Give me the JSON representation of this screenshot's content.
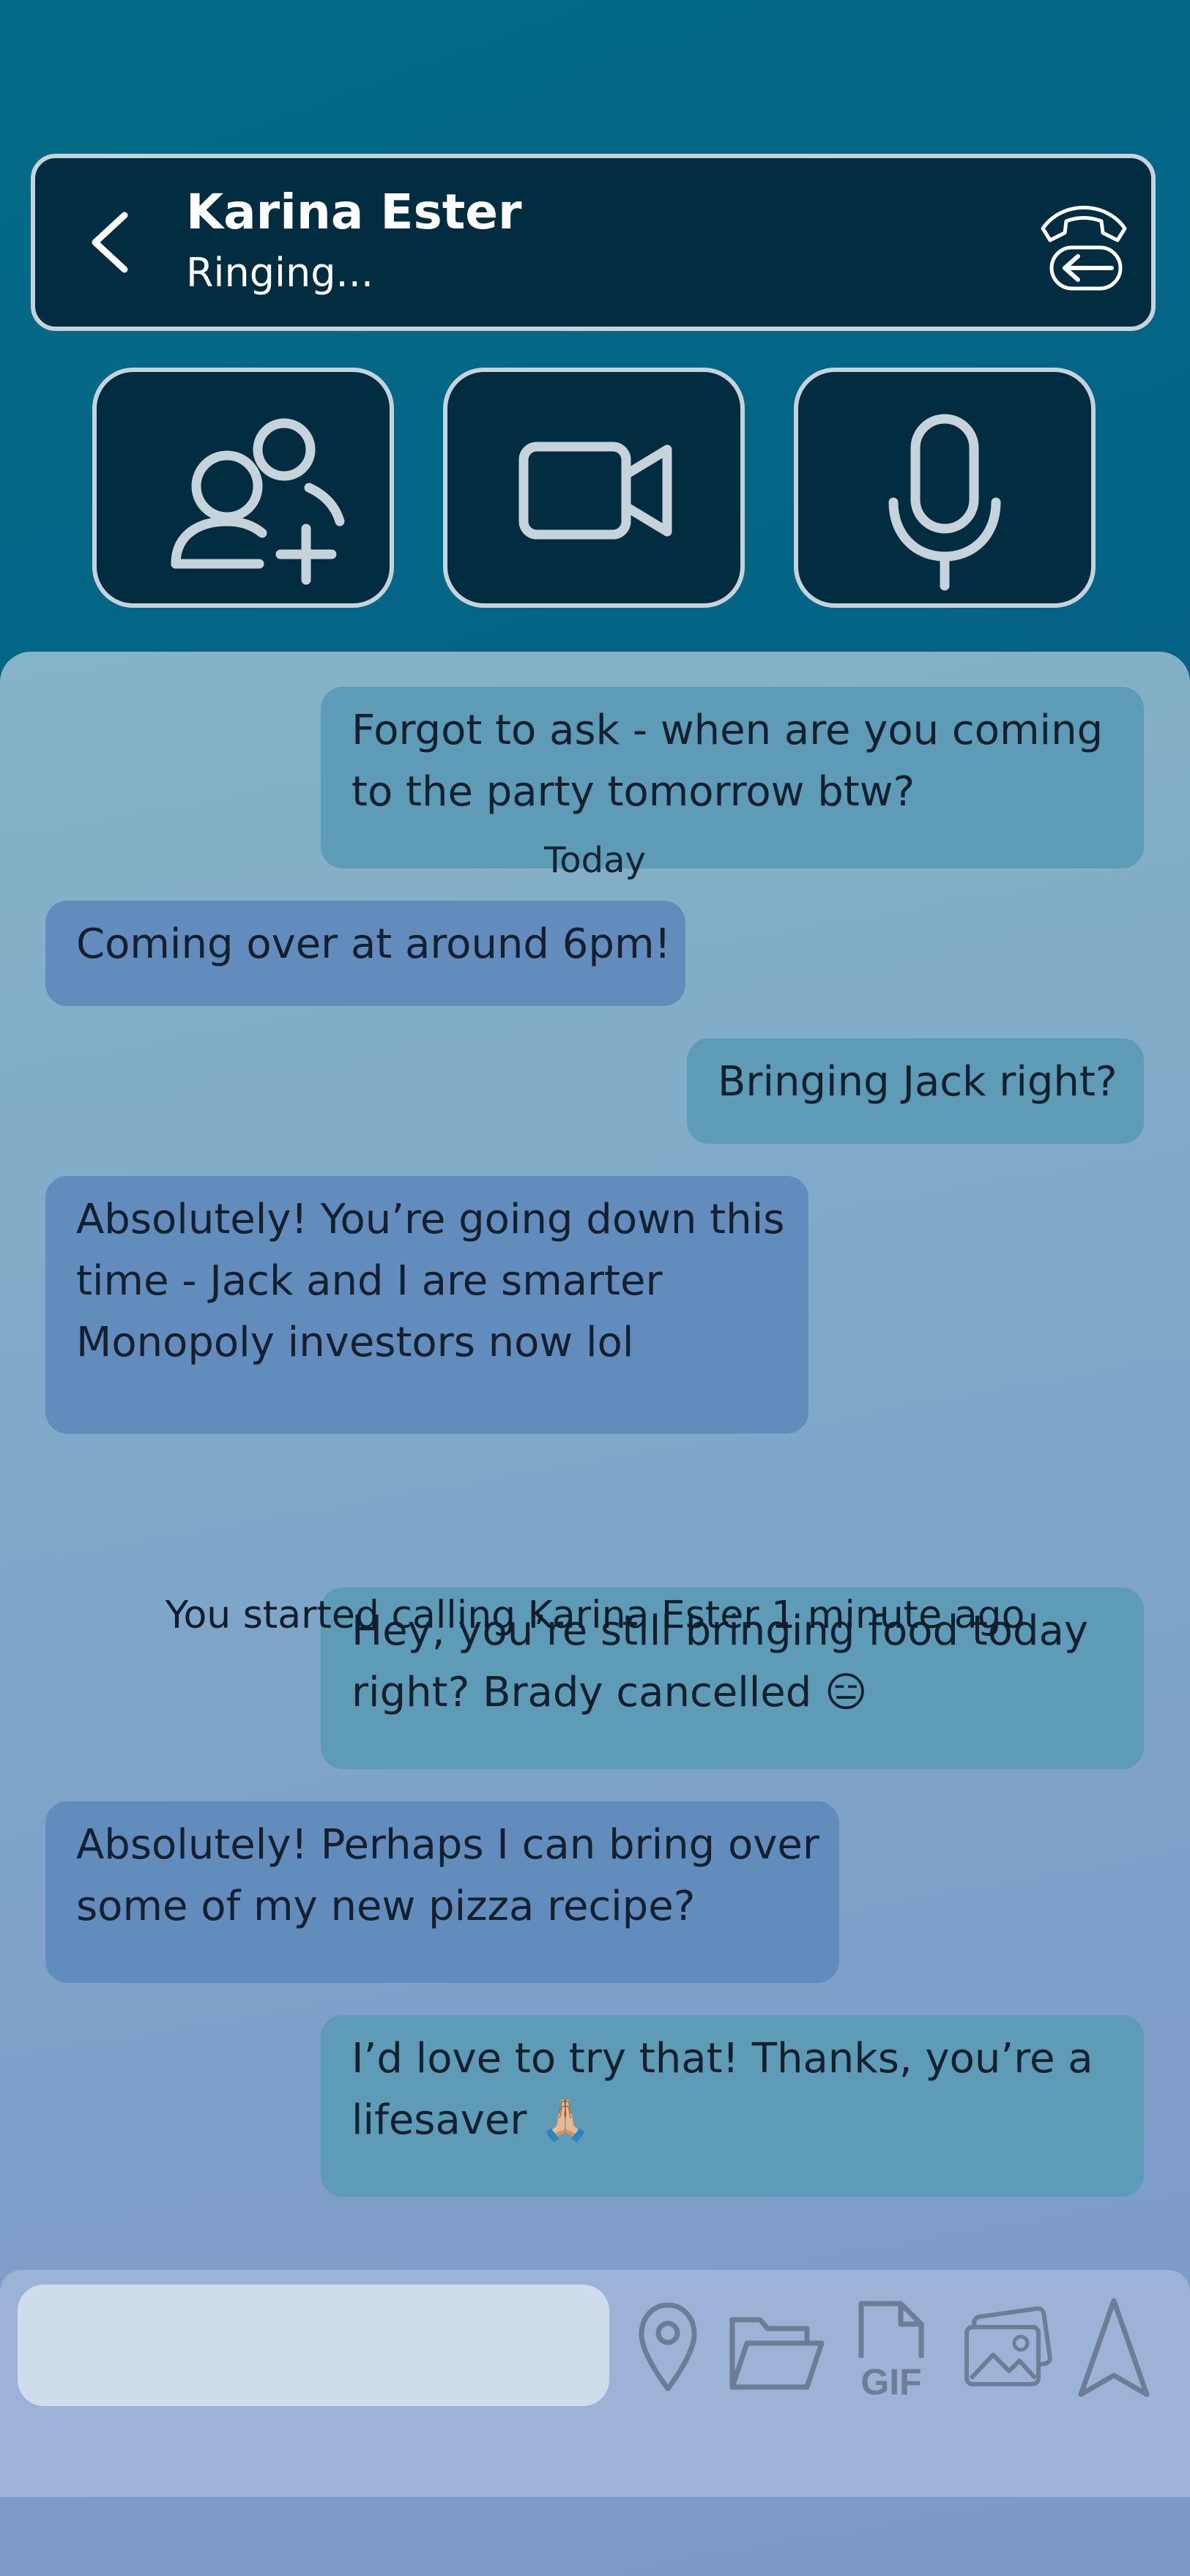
{
  "header": {
    "contact_name": "Karina Ester",
    "status": "Ringing..."
  },
  "icons": {
    "back": "chevron-left-icon",
    "hangup": "end-call-icon",
    "add_person": "add-person-icon",
    "video": "video-camera-icon",
    "microphone": "microphone-icon",
    "location": "location-pin-icon",
    "folder": "folder-icon",
    "gif": "gif-icon",
    "gallery": "photo-gallery-icon",
    "send": "send-icon"
  },
  "messages": [
    {
      "direction": "outgoing",
      "lines": [
        "Forgot to ask - when are you coming",
        "to the party tomorrow btw?"
      ]
    },
    {
      "direction": "incoming",
      "lines": [
        "Coming over at around 6pm!"
      ]
    },
    {
      "direction": "outgoing",
      "lines": [
        "Bringing Jack right?"
      ]
    },
    {
      "direction": "incoming",
      "lines": [
        "Absolutely! You’re going down this",
        "time - Jack and I are smarter",
        "Monopoly investors now lol"
      ]
    },
    {
      "direction": "outgoing",
      "lines": [
        "Hey, you’re still bringing food today",
        "right? Brady cancelled 😑"
      ]
    },
    {
      "direction": "incoming",
      "lines": [
        "Absolutely! Perhaps I can bring over",
        "some of my new pizza recipe?"
      ]
    },
    {
      "direction": "outgoing",
      "lines": [
        "I’d love to try that! Thanks, you’re a",
        "lifesaver 🙏🏼"
      ]
    }
  ],
  "day_separator": "Today",
  "call_note": "You started calling Karina Ester 1 minute ago",
  "composer": {
    "input_value": "",
    "input_placeholder": ""
  },
  "colors": {
    "header_bg": "#022c3f",
    "border": "#c6d3da",
    "outgoing_bubble": "#5d9bb7",
    "incoming_bubble": "#628cbc",
    "composer_bg": "#9cb2d7"
  }
}
